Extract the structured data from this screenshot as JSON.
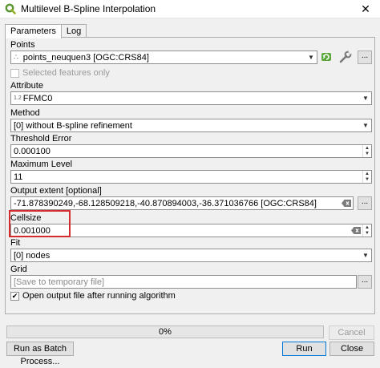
{
  "window": {
    "title": "Multilevel B-Spline Interpolation"
  },
  "tabs": [
    {
      "label": "Parameters"
    },
    {
      "label": "Log"
    }
  ],
  "points": {
    "label": "Points",
    "value": "points_neuquen3 [OGC:CRS84]",
    "selected_features_label": "Selected features only",
    "more_button": "..."
  },
  "attribute": {
    "label": "Attribute",
    "type_prefix": "1.2",
    "value": "FFMC0"
  },
  "method": {
    "label": "Method",
    "value": "[0] without B-spline refinement"
  },
  "threshold": {
    "label": "Threshold Error",
    "value": "0.000100"
  },
  "max_level": {
    "label": "Maximum Level",
    "value": "11"
  },
  "extent": {
    "label": "Output extent [optional]",
    "value": "-71.878390249,-68.128509218,-40.870894003,-36.371036766 [OGC:CRS84]",
    "more_button": "..."
  },
  "cellsize": {
    "label": "Cellsize",
    "value": "0.001000"
  },
  "fit": {
    "label": "Fit",
    "value": "[0] nodes"
  },
  "grid": {
    "label": "Grid",
    "placeholder": "[Save to temporary file]",
    "more_button": "..."
  },
  "open_output": {
    "label": "Open output file after running algorithm",
    "checked": true
  },
  "progress": {
    "text": "0%",
    "value": 0
  },
  "buttons": {
    "cancel": "Cancel",
    "batch": "Run as Batch Process...",
    "run": "Run",
    "close": "Close"
  },
  "colors": {
    "highlight": "#d62b2b",
    "accent": "#0078d7"
  }
}
